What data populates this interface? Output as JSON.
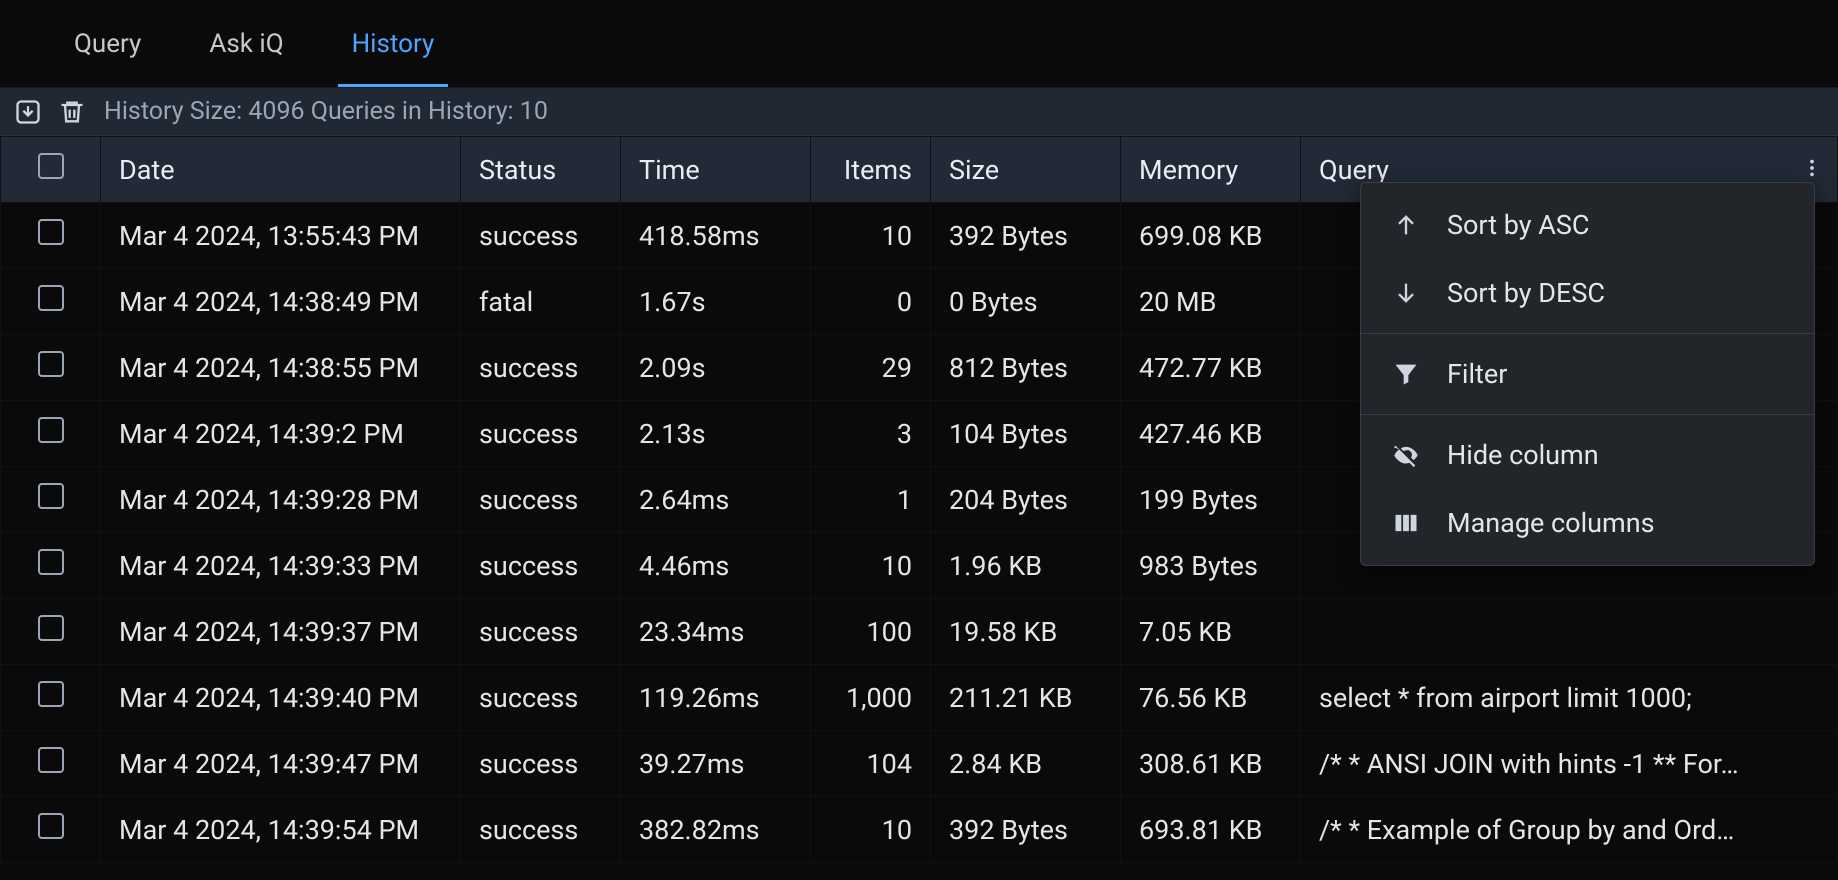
{
  "tabs": {
    "items": [
      "Query",
      "Ask iQ",
      "History"
    ],
    "active_index": 2
  },
  "toolbar": {
    "history_size_label": "History Size:",
    "history_size_value": "4096",
    "queries_in_history_label": "Queries in History:",
    "queries_in_history_value": "10",
    "full_text": "History Size: 4096 Queries in History: 10"
  },
  "table": {
    "columns": [
      "Date",
      "Status",
      "Time",
      "Items",
      "Size",
      "Memory",
      "Query"
    ],
    "rows": [
      {
        "date": "Mar 4 2024, 13:55:43 PM",
        "status": "success",
        "time": "418.58ms",
        "items": "10",
        "size": "392 Bytes",
        "memory": "699.08 KB",
        "query": ""
      },
      {
        "date": "Mar 4 2024, 14:38:49 PM",
        "status": "fatal",
        "time": "1.67s",
        "items": "0",
        "size": "0 Bytes",
        "memory": "20 MB",
        "query": ""
      },
      {
        "date": "Mar 4 2024, 14:38:55 PM",
        "status": "success",
        "time": "2.09s",
        "items": "29",
        "size": "812 Bytes",
        "memory": "472.77 KB",
        "query": ""
      },
      {
        "date": "Mar 4 2024, 14:39:2 PM",
        "status": "success",
        "time": "2.13s",
        "items": "3",
        "size": "104 Bytes",
        "memory": "427.46 KB",
        "query": ""
      },
      {
        "date": "Mar 4 2024, 14:39:28 PM",
        "status": "success",
        "time": "2.64ms",
        "items": "1",
        "size": "204 Bytes",
        "memory": "199 Bytes",
        "query": ""
      },
      {
        "date": "Mar 4 2024, 14:39:33 PM",
        "status": "success",
        "time": "4.46ms",
        "items": "10",
        "size": "1.96 KB",
        "memory": "983 Bytes",
        "query": ""
      },
      {
        "date": "Mar 4 2024, 14:39:37 PM",
        "status": "success",
        "time": "23.34ms",
        "items": "100",
        "size": "19.58 KB",
        "memory": "7.05 KB",
        "query": ""
      },
      {
        "date": "Mar 4 2024, 14:39:40 PM",
        "status": "success",
        "time": "119.26ms",
        "items": "1,000",
        "size": "211.21 KB",
        "memory": "76.56 KB",
        "query": "select * from airport limit 1000;"
      },
      {
        "date": "Mar 4 2024, 14:39:47 PM",
        "status": "success",
        "time": "39.27ms",
        "items": "104",
        "size": "2.84 KB",
        "memory": "308.61 KB",
        "query": "/* * ANSI JOIN with hints -1 ** For…"
      },
      {
        "date": "Mar 4 2024, 14:39:54 PM",
        "status": "success",
        "time": "382.82ms",
        "items": "10",
        "size": "392 Bytes",
        "memory": "693.81 KB",
        "query": "/* * Example of Group by and Ord…"
      }
    ]
  },
  "context_menu": {
    "items": [
      {
        "icon": "arrow-up-icon",
        "label": "Sort by ASC"
      },
      {
        "icon": "arrow-down-icon",
        "label": "Sort by DESC"
      },
      {
        "sep": true
      },
      {
        "icon": "filter-icon",
        "label": "Filter"
      },
      {
        "sep": true
      },
      {
        "icon": "eye-off-icon",
        "label": "Hide column"
      },
      {
        "icon": "columns-icon",
        "label": "Manage columns"
      }
    ]
  }
}
